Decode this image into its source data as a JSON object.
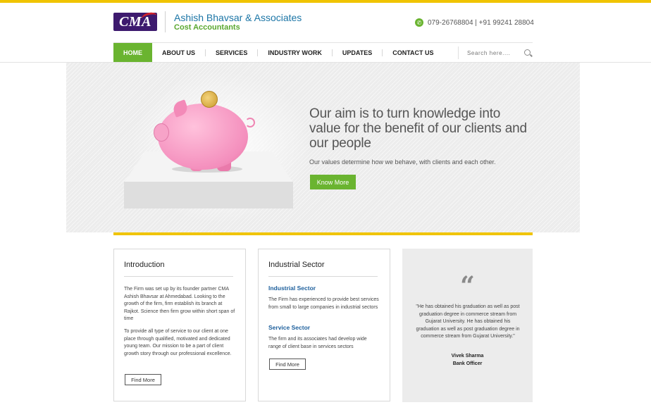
{
  "header": {
    "logo_text": "CMA",
    "firm_name": "Ashish Bhavsar & Associates",
    "firm_subtitle": "Cost Accountants",
    "phone": "079-26768804 | +91 99241 28804",
    "phone_icon": "phone-icon"
  },
  "nav": {
    "items": [
      {
        "label": "HOME",
        "active": true
      },
      {
        "label": "ABOUT US"
      },
      {
        "label": "SERVICES"
      },
      {
        "label": "INDUSTRY WORK"
      },
      {
        "label": "UPDATES"
      },
      {
        "label": "CONTACT US"
      }
    ],
    "search_placeholder": "Search here....",
    "search_icon": "search-icon"
  },
  "hero": {
    "title": "Our aim is to turn knowledge into value for the benefit of our clients and our people",
    "text": "Our values determine how we behave, with clients and each other.",
    "button": "Know More"
  },
  "cards": {
    "intro": {
      "title": "Introduction",
      "para1": "The Firm was set up by its founder partner CMA Ashish Bhavsar at Ahmedabad. Looking to the growth of the firm, firm establish its branch at Rajkot. Science then firm grow within short span of time",
      "para2": "To provide all type of service to our client at one place through qualified, motivated and dedicated young team. Our mission to be a part of client growth story through our professional excellence.",
      "button": "Find More"
    },
    "industrial": {
      "title": "Industrial Sector",
      "sub1": "Industrial Sector",
      "text1": "The Firm has experienced to provide best services from small to large companies in industrial sectors",
      "sub2": "Service Sector",
      "text2": "The firm and its associates had develop wide range of client base in services sectors",
      "button": "Find More"
    },
    "testimonial": {
      "quote_icon": "quote-icon",
      "quote": "\"He has obtained his graduation as well as post graduation degree in commerce stream from Gujarat University. He has obtained his graduation as well as post graduation degree in commerce stream from Gujarat University.\"",
      "name": "Vivek Sharma",
      "role": "Bank Officer"
    }
  },
  "colors": {
    "accent_green": "#6ab430",
    "accent_yellow": "#f0c400",
    "brand_blue": "#1b75a6",
    "logo_purple": "#3d1a6e"
  }
}
